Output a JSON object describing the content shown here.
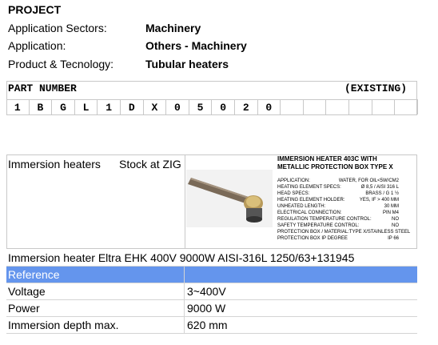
{
  "project": {
    "title": "PROJECT",
    "rows": [
      {
        "label": "Application Sectors:",
        "value": "Machinery"
      },
      {
        "label": "Application:",
        "value": "Others - Machinery"
      },
      {
        "label": "Product & Tecnology:",
        "value": "Tubular heaters"
      }
    ]
  },
  "part_number": {
    "header": "PART NUMBER",
    "status": "(EXISTING)",
    "chars": [
      "1",
      "B",
      "G",
      "L",
      "1",
      "D",
      "X",
      "0",
      "5",
      "0",
      "2",
      "0",
      "",
      "",
      "",
      "",
      "",
      ""
    ]
  },
  "product": {
    "name": "Immersion heaters",
    "stock": "Stock at ZIG",
    "spec_sheet": {
      "title": "IMMERSION HEATER 403C WITH METALLIC PROTECTION BOX TYPE X",
      "rows": [
        {
          "k": "APPLICATION:",
          "v": "WATER, FOR OIL<5W/CM2"
        },
        {
          "k": "HEATING ELEMENT SPECS:",
          "v": "Ø 8,5 / AISI 316 L"
        },
        {
          "k": "HEAD SPECS:",
          "v": "BRASS / G 1 ½"
        },
        {
          "k": "HEATING ELEMENT HOLDER:",
          "v": "YES, IF > 400 MM"
        },
        {
          "k": "UNHEATED LENGTH:",
          "v": "30 MM"
        },
        {
          "k": "ELECTRICAL CONNECTION:",
          "v": "PIN M4"
        },
        {
          "k": "REGULATION TEMPERATURE CONTROL:",
          "v": "NO"
        },
        {
          "k": "SAFETY TEMPERATURE CONTROL:",
          "v": "NO"
        },
        {
          "k": "PROTECTION BOX / MATERIAL:",
          "v": "TYPE X/STAINLESS STEEL"
        },
        {
          "k": "PROTECTION BOX IP DEGREE",
          "v": "IP 66"
        }
      ]
    }
  },
  "details": {
    "full_name": "Immersion heater Eltra  EHK 400V 9000W AISI-316L 1250/63+131945",
    "reference_label": "Reference",
    "rows": [
      {
        "label": "Voltage",
        "value": "3~400V"
      },
      {
        "label": "Power",
        "value": "9000 W"
      },
      {
        "label": "Immersion depth max.",
        "value": "620 mm"
      }
    ]
  }
}
